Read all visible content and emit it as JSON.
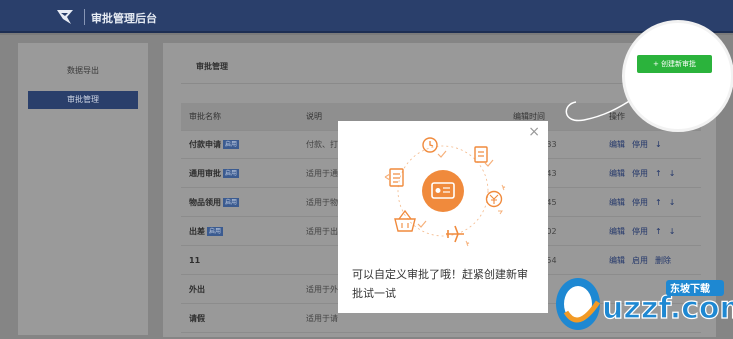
{
  "header": {
    "app_title": "审批管理后台"
  },
  "sidebar": {
    "items": [
      {
        "label": "数据导出"
      },
      {
        "label": "审批管理"
      }
    ]
  },
  "main": {
    "title": "审批管理",
    "create_button": "+ 创建新审批",
    "table": {
      "headers": [
        "审批名称",
        "说明",
        "编辑时间",
        "操作"
      ],
      "rows": [
        {
          "name": "付款申请",
          "badge": "启用",
          "desc": "付款、打",
          "time": "8 19:09:33",
          "ops": [
            "编辑",
            "停用",
            "↓"
          ]
        },
        {
          "name": "通用审批",
          "badge": "启用",
          "desc": "适用于通",
          "time": "0 22:23:43",
          "ops": [
            "编辑",
            "停用",
            "↑",
            "↓"
          ]
        },
        {
          "name": "物品领用",
          "badge": "启用",
          "desc": "适用于物",
          "time": "0 18:20:45",
          "ops": [
            "编辑",
            "停用",
            "↑",
            "↓"
          ]
        },
        {
          "name": "出差",
          "badge": "启用",
          "desc": "适用于出",
          "time": "0 19:35:02",
          "ops": [
            "编辑",
            "停用",
            "↑",
            "↓"
          ]
        },
        {
          "name": "11",
          "badge": "",
          "desc": "",
          "time": "9 14:10:54",
          "ops": [
            "编辑",
            "启用",
            "删除"
          ]
        },
        {
          "name": "外出",
          "badge": "",
          "desc": "适用于外",
          "time": "",
          "ops": []
        },
        {
          "name": "请假",
          "badge": "",
          "desc": "适用于请",
          "time": "",
          "ops": []
        }
      ]
    }
  },
  "modal": {
    "text": "可以自定义审批了哦！赶紧创建新审批试一试",
    "close": "×"
  },
  "colors": {
    "header": "#2a3f6b",
    "accent": "#2bb33c",
    "illustration": "#f0883a"
  },
  "watermark": {
    "text": "uzzf.com",
    "subtext": "东坡下载"
  }
}
